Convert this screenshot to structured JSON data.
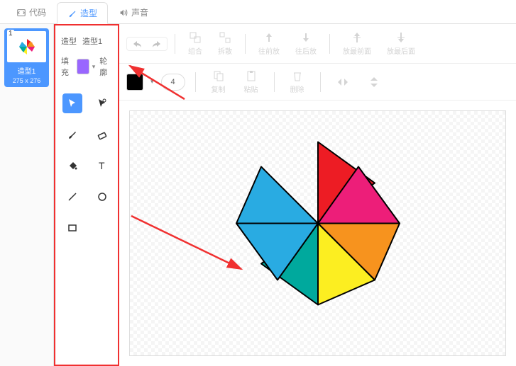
{
  "tabs": {
    "code": "代码",
    "costume": "造型",
    "sound": "声音"
  },
  "thumbnail": {
    "number": "1",
    "name": "造型1",
    "dims": "275 x 276"
  },
  "costume": {
    "label": "造型",
    "name": "造型1"
  },
  "fill": {
    "label": "填充",
    "color": "#9966ff",
    "outline_label": "轮廓",
    "outline_color": "#000000",
    "width": "4"
  },
  "toolbar": {
    "undo": "撤销",
    "redo": "重做",
    "group": "组合",
    "ungroup": "拆散",
    "forward": "往前放",
    "backward": "往后放",
    "front": "放最前面",
    "back": "放最后面",
    "copy": "复制",
    "paste": "粘贴",
    "delete": "删除"
  },
  "tools": {
    "select": "select",
    "reshape": "reshape",
    "brush": "brush",
    "eraser": "eraser",
    "fillbucket": "fillbucket",
    "text": "text",
    "line": "line",
    "circle": "circle",
    "rect": "rect"
  },
  "colors": {
    "blue": "#29abe2",
    "red": "#ed1c24",
    "magenta": "#ed1e79",
    "orange": "#f7931e",
    "cyan": "#00a99d",
    "yellow": "#fcee21"
  }
}
